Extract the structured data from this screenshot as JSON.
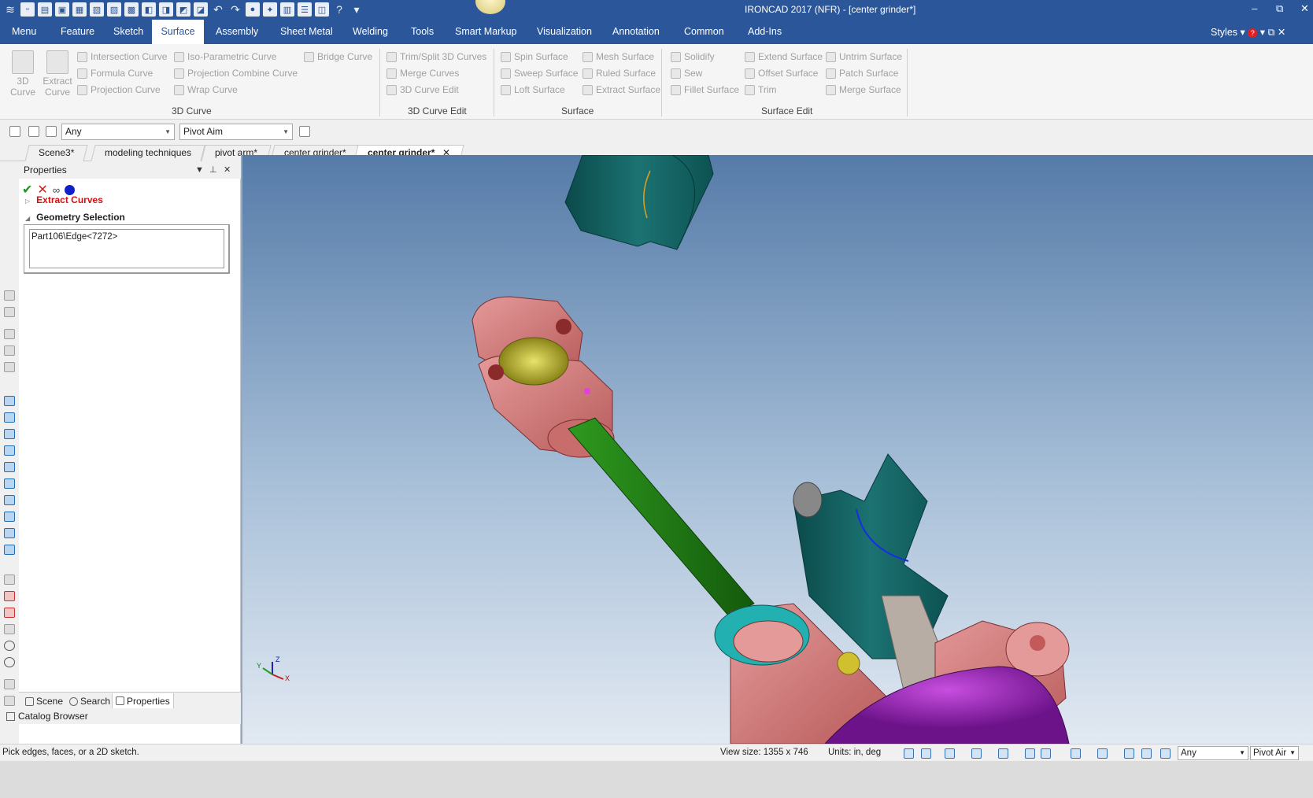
{
  "window": {
    "title": "IRONCAD 2017 (NFR) - [center grinder*]",
    "controls": {
      "minimize": "–",
      "restore": "⧉",
      "close": "✕"
    }
  },
  "ribbon_tabs": [
    {
      "label": "Menu"
    },
    {
      "label": "Feature"
    },
    {
      "label": "Sketch"
    },
    {
      "label": "Surface",
      "active": true
    },
    {
      "label": "Assembly"
    },
    {
      "label": "Sheet Metal"
    },
    {
      "label": "Welding"
    },
    {
      "label": "Tools"
    },
    {
      "label": "Smart Markup"
    },
    {
      "label": "Visualization"
    },
    {
      "label": "Annotation"
    },
    {
      "label": "Common"
    },
    {
      "label": "Add-Ins"
    }
  ],
  "styles": {
    "label": "Styles",
    "help_icon": "help-icon"
  },
  "ribbon": {
    "curve3d": {
      "label": "3D Curve",
      "big_3d_curve_line1": "3D",
      "big_3d_curve_line2": "Curve",
      "big_extract_line1": "Extract",
      "big_extract_line2": "Curve",
      "intersection_curve": "Intersection Curve",
      "iso_parametric_curve": "Iso-Parametric Curve",
      "bridge_curve": "Bridge Curve",
      "formula_curve": "Formula Curve",
      "projection_combine_curve": "Projection Combine Curve",
      "projection_curve": "Projection Curve",
      "wrap_curve": "Wrap Curve"
    },
    "curve_edit": {
      "label": "3D Curve Edit",
      "trim_split": "Trim/Split 3D Curves",
      "merge_curves": "Merge Curves",
      "curve_edit": "3D Curve Edit"
    },
    "surface": {
      "label": "Surface",
      "spin_surface": "Spin Surface",
      "mesh_surface": "Mesh Surface",
      "sweep_surface": "Sweep Surface",
      "ruled_surface": "Ruled Surface",
      "loft_surface": "Loft Surface",
      "extract_surface": "Extract Surface"
    },
    "surface_edit": {
      "label": "Surface Edit",
      "solidify": "Solidify",
      "extend_surface": "Extend Surface",
      "untrim_surface": "Untrim Surface",
      "sew": "Sew",
      "offset_surface": "Offset Surface",
      "patch_surface": "Patch Surface",
      "fillet_surface": "Fillet Surface",
      "trim": "Trim",
      "merge_surface": "Merge Surface"
    }
  },
  "selection_toolbar": {
    "filter_value": "Any",
    "mode_value": "Pivot Aim"
  },
  "doc_tabs": [
    {
      "label": "Scene3*"
    },
    {
      "label": "modeling techniques"
    },
    {
      "label": "pivot arm*"
    },
    {
      "label": "center grinder*"
    },
    {
      "label": "center grinder*",
      "active": true,
      "close": "✕"
    }
  ],
  "properties": {
    "title": "Properties",
    "header_controls": {
      "dropdown": "▼",
      "pin": "📌",
      "close": "✕"
    },
    "actions": {
      "ok": "✔",
      "cancel": "✕",
      "preview": "∞"
    },
    "extract_curves": "Extract Curves",
    "geometry_selection": "Geometry Selection",
    "geometry_value": "Part106\\Edge<7272>"
  },
  "panel_tabs": [
    {
      "label": "Scene"
    },
    {
      "label": "Search"
    },
    {
      "label": "Properties",
      "active": true
    }
  ],
  "catalog_browser": "Catalog Browser",
  "triad": {
    "x": "X",
    "y": "Y",
    "z": "Z"
  },
  "status": {
    "message": "Pick edges, faces, or a 2D sketch.",
    "view_size": "View size: 1355 x  746",
    "units": "Units: in, deg",
    "filter_value": "Any",
    "mode_value": "Pivot Air"
  },
  "colors": {
    "title_bar": "#2b579a",
    "teal_part": "#0f5d5d",
    "salmon_part": "#d67878",
    "green_shaft": "#1f7a12",
    "magenta_part": "#9b22b8",
    "yellow_ball": "#b7b52a"
  }
}
